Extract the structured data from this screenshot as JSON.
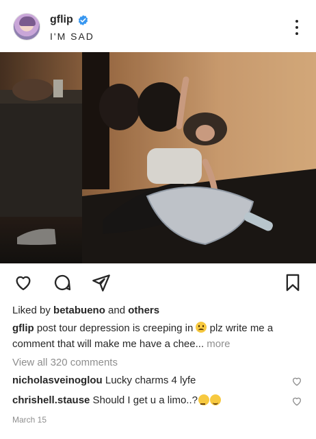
{
  "post": {
    "username": "gflip",
    "subtitle": "I'M SAD",
    "liked_prefix": "Liked by ",
    "liked_user": "betabueno",
    "liked_mid": " and ",
    "liked_suffix": "others",
    "caption_user": "gflip",
    "caption_part1": " post tour depression is creeping in ",
    "caption_part2": " plz write me a comment that will make me have a chee",
    "caption_ellipsis": "... ",
    "caption_more": "more",
    "view_all": "View all 320 comments",
    "comments": [
      {
        "user": "nicholasveinoglou",
        "text": " Lucky charms 4 lyfe"
      },
      {
        "user": "chrishell.stause",
        "text": " Should I get u a limo..?"
      }
    ],
    "date": "March 15"
  },
  "icons": {
    "verified": "verified-badge-icon",
    "more": "more-options-icon",
    "like": "heart-icon",
    "comment": "comment-icon",
    "share": "share-icon",
    "save": "bookmark-icon"
  },
  "colors": {
    "text": "#262626",
    "muted": "#8e8e8e",
    "verified": "#3897f0"
  }
}
